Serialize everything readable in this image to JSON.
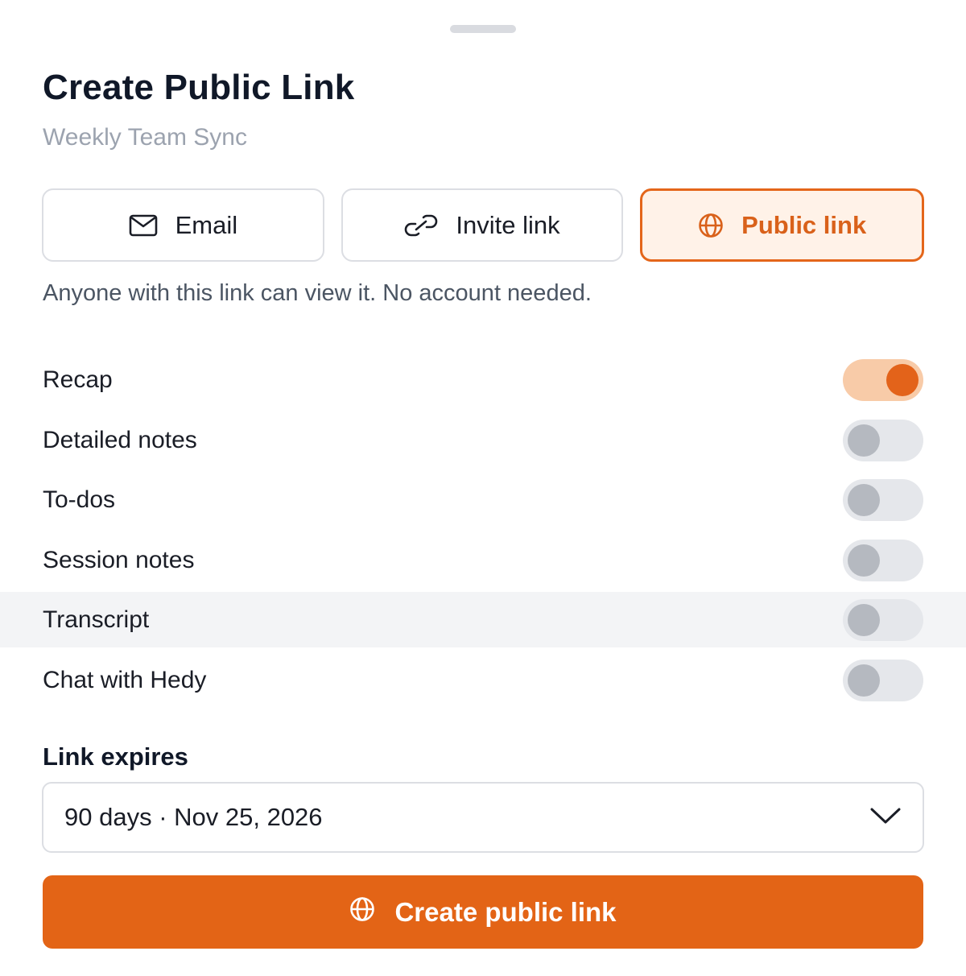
{
  "header": {
    "title": "Create Public Link",
    "subtitle": "Weekly Team Sync"
  },
  "share_methods": [
    {
      "label": "Email",
      "icon": "mail-icon",
      "active": false
    },
    {
      "label": "Invite link",
      "icon": "link-icon",
      "active": false
    },
    {
      "label": "Public link",
      "icon": "globe-icon",
      "active": true
    }
  ],
  "hint": "Anyone with this link can view it. No account needed.",
  "options": [
    {
      "label": "Recap",
      "enabled": true
    },
    {
      "label": "Detailed notes",
      "enabled": false
    },
    {
      "label": "To-dos",
      "enabled": false
    },
    {
      "label": "Session notes",
      "enabled": false
    },
    {
      "label": "Transcript",
      "enabled": false
    },
    {
      "label": "Chat with Hedy",
      "enabled": false
    }
  ],
  "expiry": {
    "label": "Link expires",
    "value": "90 days · Nov 25, 2026"
  },
  "cta": {
    "label": "Create public link",
    "icon": "globe-icon"
  },
  "colors": {
    "accent": "#e36416",
    "accent_light": "#fff2e8",
    "toggle_on_track": "#f8cba8",
    "toggle_off_track": "#e5e7eb"
  }
}
